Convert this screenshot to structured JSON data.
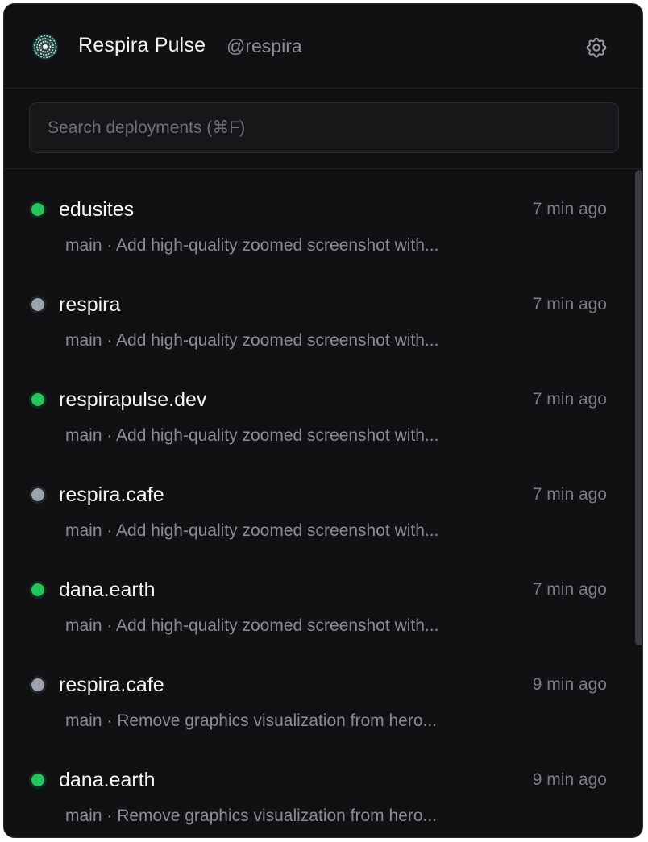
{
  "app": {
    "title": "Respira Pulse",
    "handle": "@respira",
    "logo_icon": "respira-flower-logo",
    "settings_icon": "gear-icon"
  },
  "search": {
    "placeholder": "Search deployments (⌘F)",
    "value": ""
  },
  "colors": {
    "background": "#111113",
    "status_ready": "#22c55e",
    "status_idle": "#9ca3af"
  },
  "deployments": [
    {
      "name": "edusites",
      "status": "ready",
      "time": "7 min ago",
      "branch": "main",
      "message": "Add high-quality zoomed screenshot with..."
    },
    {
      "name": "respira",
      "status": "idle",
      "time": "7 min ago",
      "branch": "main",
      "message": "Add high-quality zoomed screenshot with..."
    },
    {
      "name": "respirapulse.dev",
      "status": "ready",
      "time": "7 min ago",
      "branch": "main",
      "message": "Add high-quality zoomed screenshot with..."
    },
    {
      "name": "respira.cafe",
      "status": "idle",
      "time": "7 min ago",
      "branch": "main",
      "message": "Add high-quality zoomed screenshot with..."
    },
    {
      "name": "dana.earth",
      "status": "ready",
      "time": "7 min ago",
      "branch": "main",
      "message": "Add high-quality zoomed screenshot with..."
    },
    {
      "name": "respira.cafe",
      "status": "idle",
      "time": "9 min ago",
      "branch": "main",
      "message": "Remove graphics visualization from hero..."
    },
    {
      "name": "dana.earth",
      "status": "ready",
      "time": "9 min ago",
      "branch": "main",
      "message": "Remove graphics visualization from hero..."
    }
  ]
}
